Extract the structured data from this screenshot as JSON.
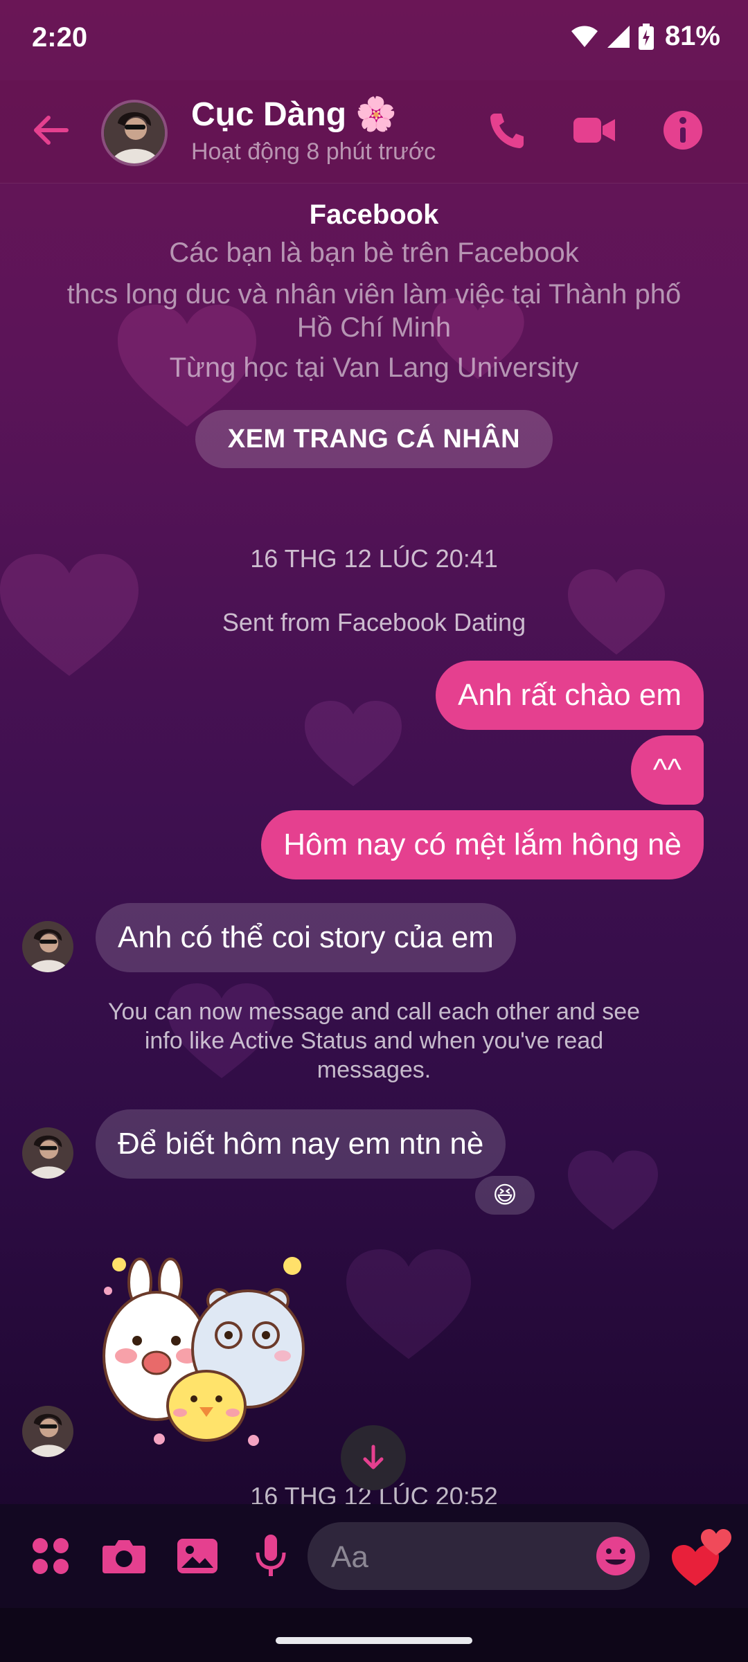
{
  "status_bar": {
    "time": "2:20",
    "battery": "81%"
  },
  "header": {
    "name": "Cục Dàng 🌸",
    "status": "Hoạt động 8 phút trước"
  },
  "intro": {
    "title": "Facebook",
    "lines": [
      "Các bạn là bạn bè trên Facebook",
      "thcs long duc và nhân viên làm việc tại Thành phố",
      "Hồ Chí Minh",
      "Từng học tại Van Lang University"
    ],
    "button": "XEM TRANG CÁ NHÂN"
  },
  "conversation": {
    "timestamp_1": "16 THG 12 LÚC 20:41",
    "dating_note": "Sent from Facebook Dating",
    "outgoing": [
      "Anh rất chào em",
      "^^",
      "Hôm nay có mệt lắm hông nè"
    ],
    "incoming_1": "Anh có thể coi story của em",
    "system_msg": "You can now message and call each other and see info like Active Status and when you've read messages.",
    "incoming_2": "Để biết hôm nay em ntn nè",
    "reaction": "😆",
    "timestamp_2": "16 THG 12 LÚC 20:52"
  },
  "composer": {
    "placeholder": "Aa"
  },
  "colors": {
    "accent": "#e5408f",
    "bubble_out": "#e5408f"
  }
}
